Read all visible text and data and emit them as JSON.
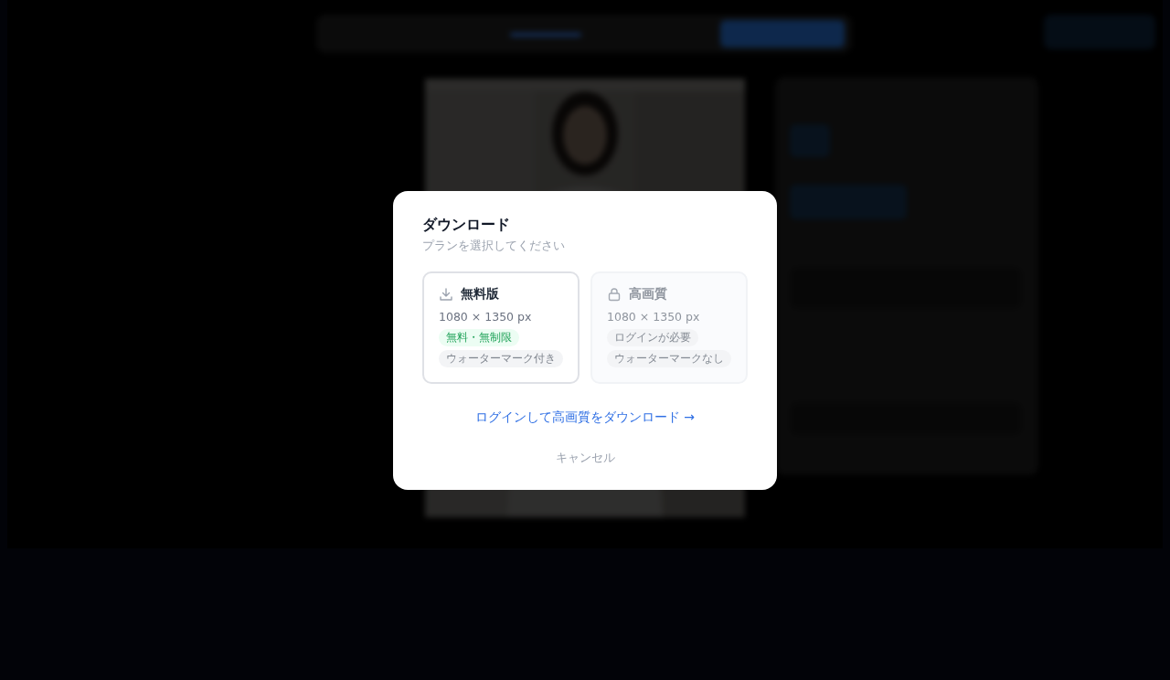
{
  "dialog": {
    "title": "ダウンロード",
    "subtitle": "プランを選択してください",
    "plans": [
      {
        "kind": "free",
        "name": "無料版",
        "resolution": "1080 × 1350 px",
        "selected": true,
        "disabled": false,
        "badges": [
          {
            "text": "無料・無制限",
            "kind": "green"
          },
          {
            "text": "ウォーターマーク付き",
            "kind": "grey"
          }
        ]
      },
      {
        "kind": "locked",
        "name": "高画質",
        "resolution": "1080 × 1350 px",
        "selected": false,
        "disabled": true,
        "badges": [
          {
            "text": "ログインが必要",
            "kind": "grey"
          },
          {
            "text": "ウォーターマークなし",
            "kind": "grey"
          }
        ]
      }
    ],
    "login_link": "ログインして高画質をダウンロード →",
    "cancel": "キャンセル"
  }
}
